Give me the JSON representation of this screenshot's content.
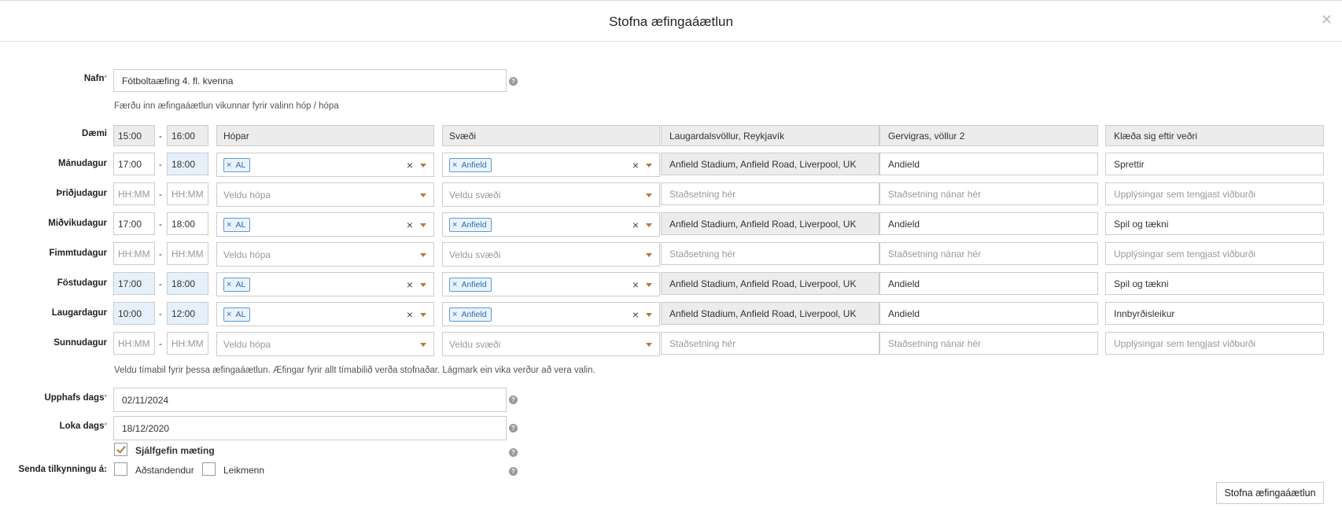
{
  "modal": {
    "title": "Stofna æfingaáætlun",
    "close_icon": "close-icon"
  },
  "name": {
    "label": "Nafn",
    "required_mark": "*",
    "value": "Fótboltaæfing 4. fl. kvenna"
  },
  "schedule_hint": "Færðu inn æfingaáætlun vikunnar fyrir valinn hóp / hópa",
  "example_row": {
    "label": "Dæmi",
    "start": "15:00",
    "end": "16:00",
    "groups": "Hópar",
    "area": "Svæði",
    "location": "Laugardalsvöllur, Reykjavík",
    "location_detail": "Gervigras, völlur 2",
    "info": "Klæða sig eftir veðri"
  },
  "placeholders": {
    "time": "HH:MM",
    "groups": "Veldu hópa",
    "area": "Veldu svæði",
    "location": "Staðsetning hér",
    "location_detail": "Staðsetning nánar hér",
    "info": "Upplýsingar sem tengjast viðburði"
  },
  "days": [
    {
      "label": "Mánudagur",
      "start": "17:00",
      "end": "18:00",
      "group_tag": "AL",
      "area_tag": "Anfield",
      "location": "Anfield Stadium, Anfield Road, Liverpool, UK",
      "location_detail": "Andield",
      "info": "Sprettir"
    },
    {
      "label": "Þriðjudagur",
      "start": "",
      "end": "",
      "group_tag": "",
      "area_tag": "",
      "location": "",
      "location_detail": "",
      "info": ""
    },
    {
      "label": "Miðvikudagur",
      "start": "17:00",
      "end": "18:00",
      "group_tag": "AL",
      "area_tag": "Anfield",
      "location": "Anfield Stadium, Anfield Road, Liverpool, UK",
      "location_detail": "Andield",
      "info": "Spil og tækni"
    },
    {
      "label": "Fimmtudagur",
      "start": "",
      "end": "",
      "group_tag": "",
      "area_tag": "",
      "location": "",
      "location_detail": "",
      "info": ""
    },
    {
      "label": "Föstudagur",
      "start": "17:00",
      "end": "18:00",
      "group_tag": "AL",
      "area_tag": "Anfield",
      "location": "Anfield Stadium, Anfield Road, Liverpool, UK",
      "location_detail": "Andield",
      "info": "Spil og tækni"
    },
    {
      "label": "Laugardagur",
      "start": "10:00",
      "end": "12:00",
      "group_tag": "AL",
      "area_tag": "Anfield",
      "location": "Anfield Stadium, Anfield Road, Liverpool, UK",
      "location_detail": "Andield",
      "info": "Innbyrðisleikur"
    },
    {
      "label": "Sunnudagur",
      "start": "",
      "end": "",
      "group_tag": "",
      "area_tag": "",
      "location": "",
      "location_detail": "",
      "info": ""
    }
  ],
  "period_hint": "Veldu tímabil fyrir þessa æfingaáætlun. Æfingar fyrir allt tímabilið verða stofnaðar. Lágmark ein vika verður að vera valin.",
  "start_date": {
    "label": "Upphafs dags",
    "required_mark": "*",
    "value": "02/11/2024"
  },
  "end_date": {
    "label": "Loka dags",
    "required_mark": "*",
    "value": "18/12/2020"
  },
  "default_attendance": {
    "label": "Sjálfgefin mæting",
    "checked": true
  },
  "notify": {
    "label": "Senda tilkynningu á:",
    "options": [
      "Aðstandendur",
      "Leikmenn"
    ]
  },
  "help_glyph": "?",
  "submit_label": "Stofna æfingaáætlun"
}
